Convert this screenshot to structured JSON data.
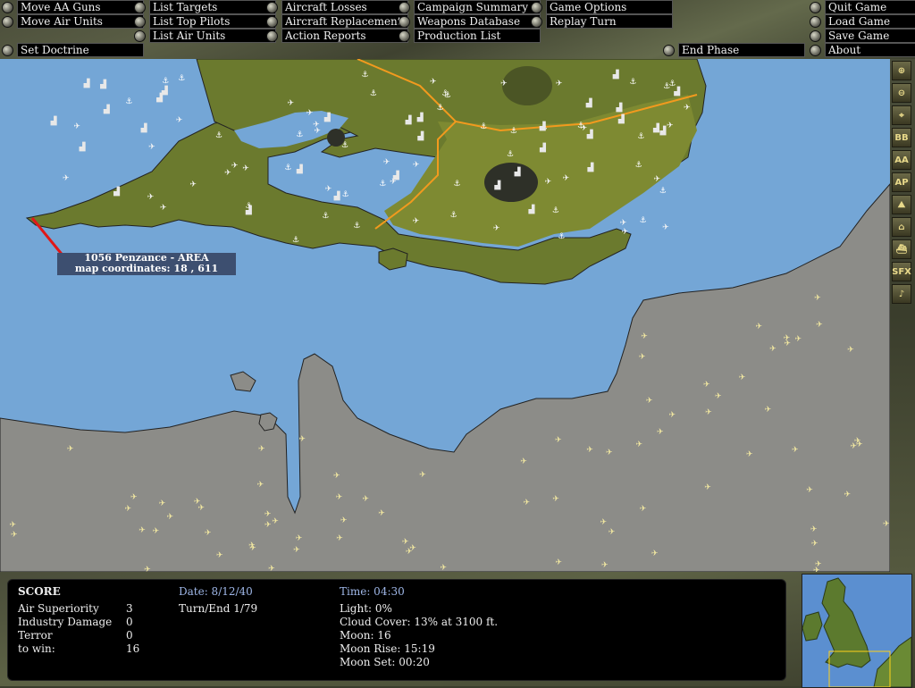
{
  "menu": {
    "col1": [
      "Move AA Guns",
      "Move Air Units",
      "Set Doctrine"
    ],
    "col2": [
      "List Targets",
      "List Top Pilots",
      "List Air Units"
    ],
    "col3": [
      "Aircraft Losses",
      "Aircraft Replacements",
      "Action Reports"
    ],
    "col4": [
      "Campaign Summary",
      "Weapons Database",
      "Production List"
    ],
    "col5": [
      "Game Options",
      "Replay Turn"
    ],
    "end_phase": "End Phase",
    "right": [
      "Quit Game",
      "Load Game",
      "Save Game",
      "About"
    ]
  },
  "toolbar": {
    "tools": [
      {
        "icon": "zoom-in-icon",
        "label": "⊕"
      },
      {
        "icon": "zoom-out-icon",
        "label": "⊖"
      },
      {
        "icon": "crosshair-icon",
        "label": "⌖"
      },
      {
        "icon": "bb-icon",
        "label": "BB"
      },
      {
        "icon": "aa-icon",
        "label": "AA"
      },
      {
        "icon": "ap-icon",
        "label": "AP"
      },
      {
        "icon": "terrain-icon",
        "label": "⛰"
      },
      {
        "icon": "building-icon",
        "label": "⌂"
      },
      {
        "icon": "ship-icon",
        "label": "⛴"
      },
      {
        "icon": "sfx-icon",
        "label": "SFX"
      },
      {
        "icon": "music-icon",
        "label": "♪"
      }
    ]
  },
  "tooltip": {
    "line1": "1056 Penzance - AREA",
    "line2": "map coordinates: 18 , 611"
  },
  "score": {
    "title": "SCORE",
    "rows": [
      {
        "label": "Air Superiority",
        "value": "3"
      },
      {
        "label": "Industry Damage",
        "value": "0"
      },
      {
        "label": "Terror",
        "value": "0"
      },
      {
        "label": "to win:",
        "value": "16"
      }
    ],
    "date": "Date: 8/12/40",
    "turn": "Turn/End 1/79",
    "time": "Time: 04:30",
    "conditions": [
      "Light: 0%",
      "Cloud Cover: 13% at 3100 ft.",
      "Moon: 16",
      "Moon Rise: 15:19",
      "Moon Set: 00:20"
    ]
  },
  "colors": {
    "sea": "#74a6d6",
    "england": "#6b7a2e",
    "france": "#8c8c88",
    "border": "#f29a1e"
  }
}
